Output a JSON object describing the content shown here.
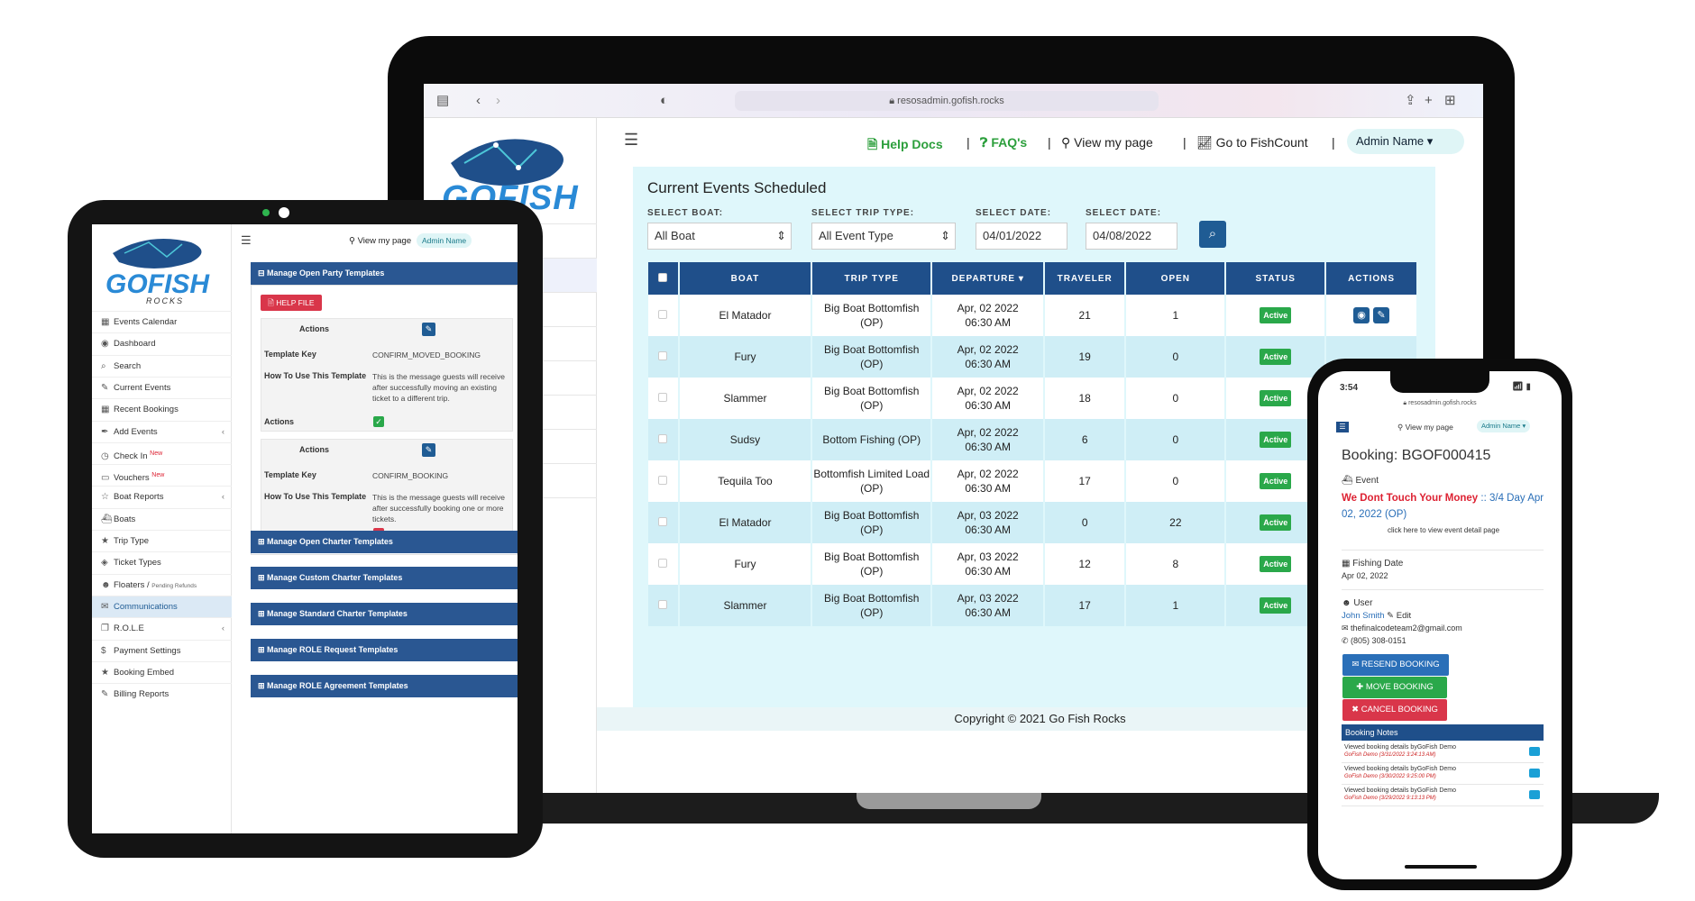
{
  "laptop": {
    "browser": {
      "url": "resosadmin.gofish.rocks"
    },
    "logo": {
      "text": "GOFISH"
    },
    "topnav": {
      "help_docs": "Help Docs",
      "faqs": "FAQ's",
      "view_page": "View my page",
      "fishcount": "Go to FishCount",
      "admin": "Admin Name"
    },
    "events": {
      "title": "Current Events Scheduled",
      "filters": {
        "boat_label": "SELECT BOAT:",
        "boat_value": "All Boat",
        "trip_label": "SELECT TRIP TYPE:",
        "trip_value": "All Event Type",
        "date1_label": "SELECT DATE:",
        "date1_value": "04/01/2022",
        "date2_label": "SELECT DATE:",
        "date2_value": "04/08/2022"
      },
      "columns": [
        "BOAT",
        "TRIP TYPE",
        "DEPARTURE",
        "TRAVELER",
        "OPEN",
        "STATUS",
        "ACTIONS"
      ],
      "rows": [
        {
          "boat": "El Matador",
          "trip": "Big Boat Bottomfish (OP)",
          "date": "Apr, 02 2022",
          "time": "06:30 AM",
          "traveler": "21",
          "open": "1",
          "status": "Active"
        },
        {
          "boat": "Fury",
          "trip": "Big Boat Bottomfish (OP)",
          "date": "Apr, 02 2022",
          "time": "06:30 AM",
          "traveler": "19",
          "open": "0",
          "status": "Active"
        },
        {
          "boat": "Slammer",
          "trip": "Big Boat Bottomfish (OP)",
          "date": "Apr, 02 2022",
          "time": "06:30 AM",
          "traveler": "18",
          "open": "0",
          "status": "Active"
        },
        {
          "boat": "Sudsy",
          "trip": "Bottom Fishing (OP)",
          "date": "Apr, 02 2022",
          "time": "06:30 AM",
          "traveler": "6",
          "open": "0",
          "status": "Active"
        },
        {
          "boat": "Tequila Too",
          "trip": "Bottomfish Limited Load (OP)",
          "date": "Apr, 02 2022",
          "time": "06:30 AM",
          "traveler": "17",
          "open": "0",
          "status": "Active"
        },
        {
          "boat": "El Matador",
          "trip": "Big Boat Bottomfish (OP)",
          "date": "Apr, 03 2022",
          "time": "06:30 AM",
          "traveler": "0",
          "open": "22",
          "status": "Active"
        },
        {
          "boat": "Fury",
          "trip": "Big Boat Bottomfish (OP)",
          "date": "Apr, 03 2022",
          "time": "06:30 AM",
          "traveler": "12",
          "open": "8",
          "status": "Active"
        },
        {
          "boat": "Slammer",
          "trip": "Big Boat Bottomfish (OP)",
          "date": "Apr, 03 2022",
          "time": "06:30 AM",
          "traveler": "17",
          "open": "1",
          "status": "Active"
        }
      ]
    },
    "footer": "Copyright © 2021 Go Fish Rocks"
  },
  "tablet": {
    "logo": {
      "text": "GOFISH",
      "sub": "ROCKS"
    },
    "topnav": {
      "view_page": "View my page",
      "admin": "Admin Name"
    },
    "nav": [
      {
        "icon": "calendar-icon",
        "glyph": "▦",
        "label": "Events Calendar"
      },
      {
        "icon": "dashboard-icon",
        "glyph": "◉",
        "label": "Dashboard"
      },
      {
        "icon": "search-icon",
        "glyph": "⌕",
        "label": "Search"
      },
      {
        "icon": "edit-icon",
        "glyph": "✎",
        "label": "Current Events"
      },
      {
        "icon": "calendar-icon",
        "glyph": "▦",
        "label": "Recent Bookings"
      },
      {
        "icon": "pen-icon",
        "glyph": "✒",
        "label": "Add Events",
        "chevron": "‹"
      },
      {
        "icon": "clock-icon",
        "glyph": "◷",
        "label": "Check In",
        "badge": "New"
      },
      {
        "icon": "ticket-icon",
        "glyph": "▭",
        "label": "Vouchers",
        "badge": "New"
      },
      {
        "icon": "star-icon",
        "glyph": "☆",
        "label": "Boat Reports",
        "chevron": "‹"
      },
      {
        "icon": "boat-icon",
        "glyph": "⛴",
        "label": "Boats"
      },
      {
        "icon": "star-icon",
        "glyph": "★",
        "label": "Trip Type"
      },
      {
        "icon": "tag-icon",
        "glyph": "◈",
        "label": "Ticket Types"
      },
      {
        "icon": "users-icon",
        "glyph": "☻",
        "label": "Floaters /",
        "sub": "Pending Refunds"
      },
      {
        "icon": "mail-icon",
        "glyph": "✉",
        "label": "Communications",
        "active": true
      },
      {
        "icon": "copy-icon",
        "glyph": "❐",
        "label": "R.O.L.E",
        "chevron": "‹"
      },
      {
        "icon": "dollar-icon",
        "glyph": "$",
        "label": "Payment Settings"
      },
      {
        "icon": "star-icon",
        "glyph": "★",
        "label": "Booking Embed"
      },
      {
        "icon": "edit-icon",
        "glyph": "✎",
        "label": "Billing Reports"
      }
    ],
    "panel": {
      "title": "Manage Open Party Templates",
      "help_button": "HELP FILE",
      "actions_label": "Actions",
      "template_key_label": "Template Key",
      "how_to_label": "How To Use This Template",
      "t1_key": "CONFIRM_MOVED_BOOKING",
      "t1_desc": "This is the message guests will receive after successfully moving an existing ticket to a different trip.",
      "t2_key": "CONFIRM_BOOKING",
      "t2_desc": "This is the message guests will receive after successfully booking one or more tickets."
    },
    "sections": [
      "Manage Open Charter Templates",
      "Manage Custom Charter Templates",
      "Manage Standard Charter Templates",
      "Manage ROLE Request Templates",
      "Manage ROLE Agreement Templates"
    ]
  },
  "phone": {
    "status": {
      "time": "3:54"
    },
    "url": "resosadmin.gofish.rocks",
    "topnav": {
      "view_page": "View my page",
      "admin": "Admin Name"
    },
    "booking_title": "Booking: BGOF000415",
    "event_label": "Event",
    "event_name": "We Dont Touch Your Money",
    "event_day": ":: 3/4 Day",
    "event_date": "Apr 02, 2022 (OP)",
    "event_link": "click here to view event detail page",
    "fishing_label": "Fishing Date",
    "fishing_date": "Apr 02, 2022",
    "user_label": "User",
    "user_name": "John Smith",
    "edit_label": "Edit",
    "email": "thefinalcodeteam2@gmail.com",
    "phone": "(805) 308-0151",
    "btn_resend": "RESEND BOOKING EMAIL",
    "btn_move": "MOVE BOOKING",
    "btn_cancel": "CANCEL BOOKING",
    "notes_title": "Booking Notes",
    "notes": [
      {
        "text": "Viewed booking details byGoFish Demo",
        "by": "GoFish Demo (3/31/2022 3:24:13 AM)"
      },
      {
        "text": "Viewed booking details byGoFish Demo",
        "by": "GoFish Demo (3/30/2022 9:25:00 PM)"
      },
      {
        "text": "Viewed booking details byGoFish Demo",
        "by": "GoFish Demo (3/29/2022 9:13:13 PM)"
      }
    ]
  }
}
